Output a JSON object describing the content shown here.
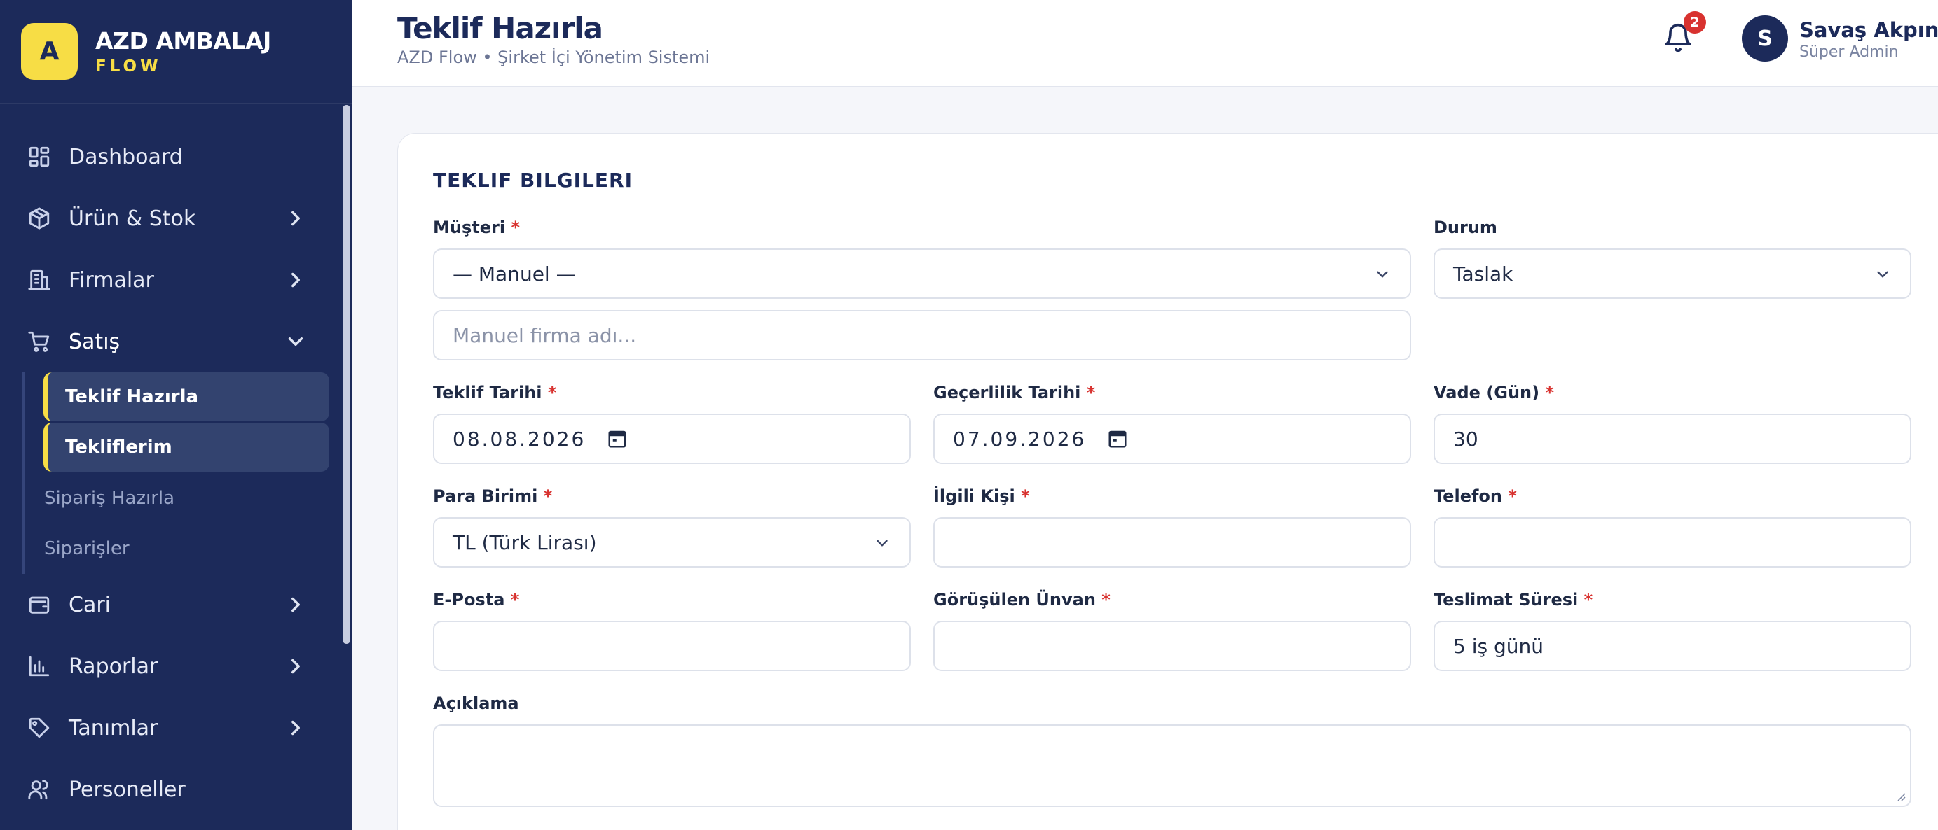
{
  "brand": {
    "logo_letter": "A",
    "name": "AZD AMBALAJ",
    "sub": "FLOW"
  },
  "sidebar": {
    "items": [
      {
        "label": "Dashboard",
        "icon": "dashboard-icon"
      },
      {
        "label": "Ürün & Stok",
        "icon": "box-icon"
      },
      {
        "label": "Firmalar",
        "icon": "building-icon"
      },
      {
        "label": "Satış",
        "icon": "cart-icon"
      },
      {
        "label": "Cari",
        "icon": "wallet-icon"
      },
      {
        "label": "Raporlar",
        "icon": "bar-chart-icon"
      },
      {
        "label": "Tanımlar",
        "icon": "tag-icon"
      },
      {
        "label": "Personeller",
        "icon": "users-icon"
      }
    ],
    "sales_sub": [
      "Teklif Hazırla",
      "Tekliflerim",
      "Sipariş Hazırla",
      "Siparişler"
    ]
  },
  "header": {
    "title": "Teklif Hazırla",
    "subtitle": "AZD Flow • Şirket İçi Yönetim Sistemi",
    "notification_count": "2",
    "user_initial": "S",
    "user_name": "Savaş Akpınar",
    "user_role": "Süper Admin"
  },
  "form": {
    "section_title": "TEKLIF BILGILERI",
    "musteri": {
      "label": "Müşteri",
      "value": "— Manuel —"
    },
    "durum": {
      "label": "Durum",
      "value": "Taslak"
    },
    "manuel_firma": {
      "placeholder": "Manuel firma adı..."
    },
    "teklif_tarihi": {
      "label": "Teklif Tarihi",
      "value": "08.08.2026"
    },
    "gecerlilik_tarihi": {
      "label": "Geçerlilik Tarihi",
      "value": "07.09.2026"
    },
    "vade": {
      "label": "Vade (Gün)",
      "value": "30"
    },
    "para_birimi": {
      "label": "Para Birimi",
      "value": "TL (Türk Lirası)"
    },
    "ilgili_kisi": {
      "label": "İlgili Kişi",
      "value": ""
    },
    "telefon": {
      "label": "Telefon",
      "value": ""
    },
    "eposta": {
      "label": "E-Posta",
      "value": ""
    },
    "gorusulen_unvan": {
      "label": "Görüşülen Ünvan",
      "value": ""
    },
    "teslimat_suresi": {
      "label": "Teslimat Süresi",
      "value": "5 iş günü"
    },
    "aciklama": {
      "label": "Açıklama",
      "value": ""
    },
    "required_mark": "*"
  },
  "colors": {
    "sidebar_bg": "#1c2a5a",
    "accent_yellow": "#f7dd45",
    "required_red": "#d8322f"
  }
}
